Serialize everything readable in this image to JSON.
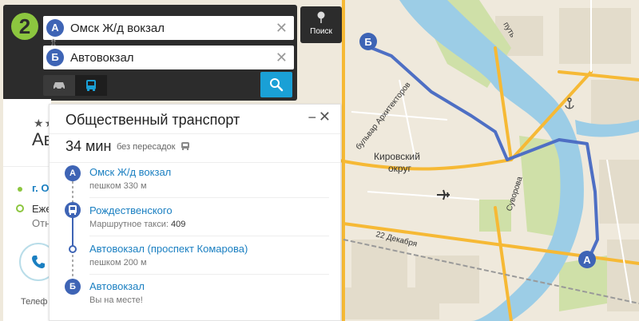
{
  "search": {
    "from": {
      "pin": "А",
      "value": "Омск Ж/д вокзал"
    },
    "to": {
      "pin": "Б",
      "value": "Автовокзал"
    },
    "clear_glyph": "✕",
    "swap_glyph": "⇕",
    "places_label": "Поиск"
  },
  "map": {
    "labels": {
      "district_line1": "Кировский",
      "district_line2": "округ",
      "street_architects": "бульвар Архитекторов",
      "street_suvorova": "Суворова",
      "street_dekabrya": "22 Декабря",
      "street_put": "путь"
    },
    "pin_start": "А",
    "pin_end": "Б",
    "route_color": "#4e6fc4"
  },
  "info_card": {
    "stars": "★★",
    "title": "Ав",
    "city": "г. О",
    "hours1": "Еже",
    "hours2": "Отн",
    "phone_label": "Телеф"
  },
  "route_card": {
    "title": "Общественный транспорт",
    "minimize": "−",
    "close": "✕",
    "duration": "34 мин",
    "transfers": "без пересадок",
    "steps": [
      {
        "icon": "А",
        "title": "Омск Ж/д вокзал",
        "sub": "пешком 330 м"
      },
      {
        "icon": "bus",
        "title": "Рождественского",
        "sub_label": "Маршрутное такси:",
        "sub_value": "409"
      },
      {
        "icon": "dot",
        "title": "Автовокзал (проспект Комарова)",
        "sub": "пешком 200 м"
      },
      {
        "icon": "Б",
        "title": "Автовокзал",
        "sub": "Вы на месте!"
      }
    ]
  },
  "colors": {
    "accent_blue": "#3e64b5",
    "search_blue": "#1aa0d6",
    "logo_green": "#8cc63f",
    "panel_dark": "#2c2c2c",
    "link_blue": "#1a7fc1"
  }
}
